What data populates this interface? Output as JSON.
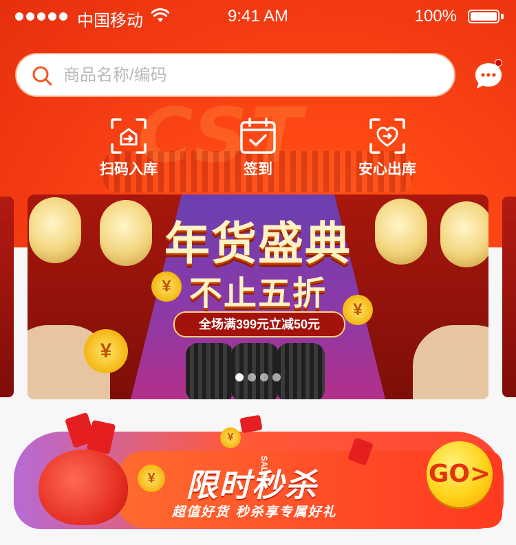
{
  "status_bar": {
    "carrier": "中国移动",
    "time": "9:41 AM",
    "battery": "100%"
  },
  "search": {
    "placeholder": "商品名称/编码"
  },
  "quick_actions": [
    {
      "label": "扫码入库",
      "icon": "scan-in-icon"
    },
    {
      "label": "签到",
      "icon": "calendar-check-icon"
    },
    {
      "label": "安心出库",
      "icon": "heart-out-icon"
    }
  ],
  "header": {
    "watermark": "CST"
  },
  "banner": {
    "title": "年货盛典",
    "subtitle": "不止五折",
    "promo": "全场满399元立减50元",
    "dots_total": 4,
    "active_dot": 1
  },
  "flash_sale": {
    "title": "限时秒杀",
    "sale_tag": "SALE",
    "subtitle": "超值好货 秒杀享专属好礼",
    "go_label": "GO>"
  },
  "colors": {
    "brand_orange": "#ff4a14",
    "accent_yellow": "#ffd31a",
    "notification_dot": "#d40000"
  }
}
